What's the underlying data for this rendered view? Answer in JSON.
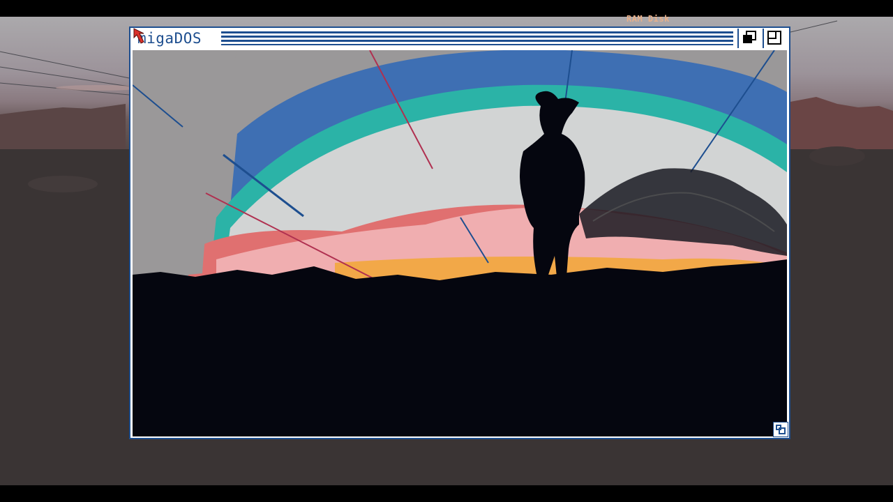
{
  "desktop": {
    "ram_disk_label": "RAM Disk"
  },
  "window": {
    "title": "AmigaDOS",
    "title_visible": "migaDOS",
    "border_color": "#1d4e8f",
    "gadgets": {
      "depth": "depth-arrange-icon",
      "zoom": "zoom-icon",
      "resize": "resize-icon"
    }
  },
  "pointer": {
    "icon": "mouse-pointer-icon",
    "color": "#d9302a"
  },
  "colors": {
    "title_blue": "#1d4e8f",
    "sky_blue": "#3e6fb3",
    "teal": "#2bb3a7",
    "pale": "#d2d4d4",
    "pink": "#f0aeb0",
    "salmon": "#e07070",
    "amber": "#f2a848",
    "ground": "#05060f"
  }
}
